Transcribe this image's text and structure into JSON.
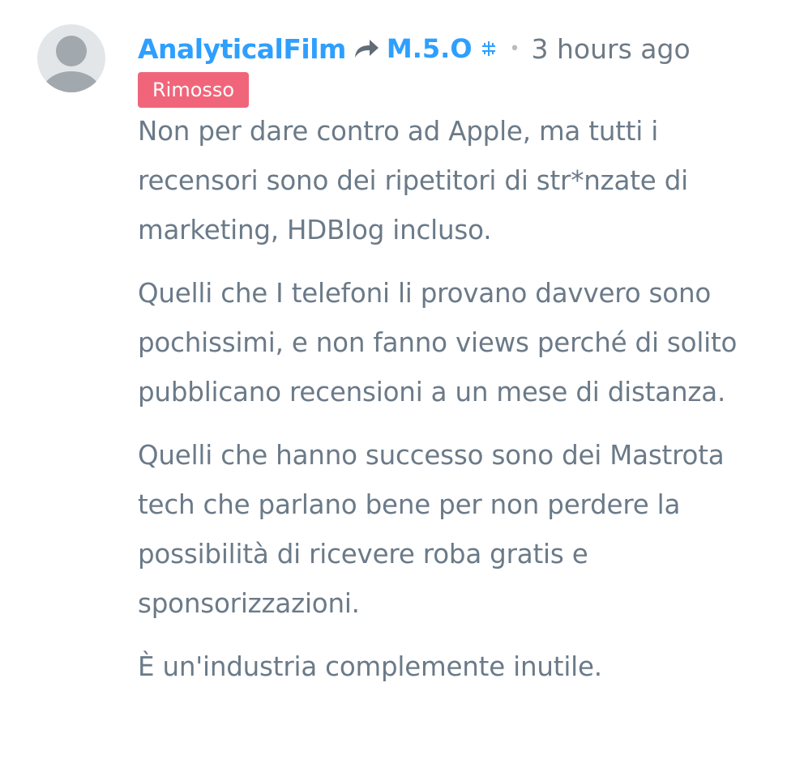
{
  "comment": {
    "author": "AnalyticalFilm",
    "reply_to": "M.5.O",
    "time": "3 hours ago",
    "badge": "Rimosso",
    "paragraphs": [
      "Non per dare contro ad Apple, ma tutti i recensori sono dei ripetitori di str*nzate di marketing, HDBlog incluso.",
      "Quelli che I telefoni li provano davvero sono pochissimi, e non fanno views perché di solito pubblicano recensioni a un mese di distanza.",
      "Quelli che hanno successo sono dei Mastrota tech che parlano bene per non perdere la possibilità di ricevere roba gratis e sponsorizzazioni.",
      "È un'industria complemente inutile."
    ]
  },
  "icons": {
    "avatar": "default-avatar-icon",
    "reply": "reply-arrow-icon",
    "reply_badge": "moderator-icon"
  },
  "colors": {
    "link": "#2e9fff",
    "text": "#6b7a88",
    "meta": "#6e7a85",
    "badge_bg": "#f0657a",
    "avatar_bg": "#e3e6e9",
    "avatar_fg": "#a1a8ae"
  }
}
